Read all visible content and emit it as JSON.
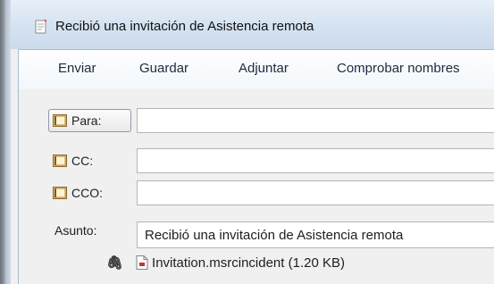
{
  "window": {
    "title": "Recibió una invitación de Asistencia remota"
  },
  "toolbar": {
    "send": "Enviar",
    "save": "Guardar",
    "attach": "Adjuntar",
    "check_names": "Comprobar nombres"
  },
  "fields": {
    "to_label": "Para:",
    "to_value": "",
    "cc_label": "CC:",
    "cc_value": "",
    "bcc_label": "CCO:",
    "bcc_value": "",
    "subject_label": "Asunto:",
    "subject_value": "Recibió una invitación de Asistencia remota"
  },
  "attachment": {
    "file": "Invitation.msrcincident (1.20 KB)"
  },
  "icons": {
    "window": "new-message-icon",
    "address_book": "address-book-icon",
    "paperclip": "paperclip-icon",
    "file": "msrc-file-icon"
  }
}
